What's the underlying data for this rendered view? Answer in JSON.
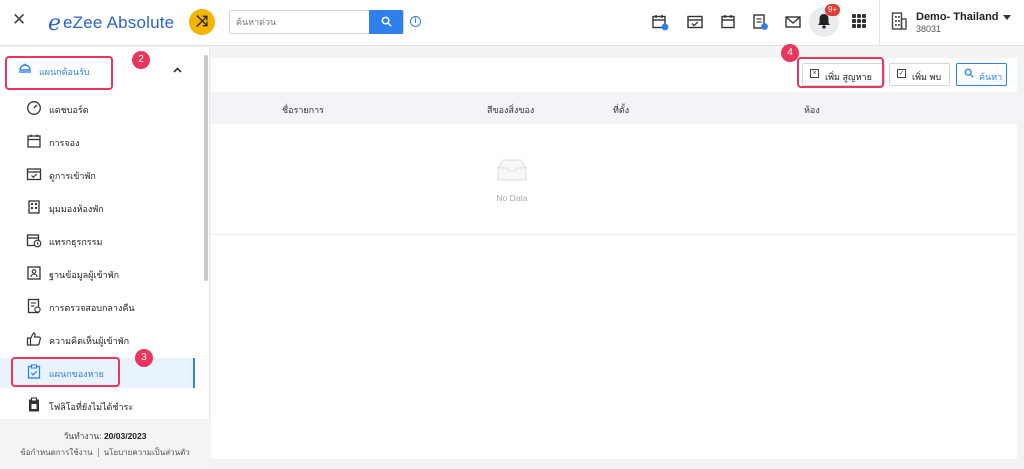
{
  "topbar": {
    "close_glyph": "✕",
    "brand_letter": "e",
    "brand_name": "eZee Absolute",
    "search_placeholder": "ค้นหาด่วน",
    "notification_badge": "9+",
    "property_name": "Demo- Thailand",
    "property_id": "38031",
    "icons": [
      "calendar-plus-icon",
      "calendar-check-icon",
      "calendar-icon",
      "report-icon",
      "mail-icon",
      "bell-icon",
      "apps-grid-icon"
    ]
  },
  "sidebar": {
    "section_label": "แผนกต้อนรับ",
    "items": [
      {
        "label": "แดชบอร์ด",
        "icon": "dashboard-gauge-icon"
      },
      {
        "label": "การจอง",
        "icon": "calendar-icon"
      },
      {
        "label": "ดูการเข้าพัก",
        "icon": "calendar-check-icon"
      },
      {
        "label": "มุมมองห้องพัก",
        "icon": "room-view-icon"
      },
      {
        "label": "แทรกธุรกรรม",
        "icon": "calendar-clock-icon"
      },
      {
        "label": "ฐานข้อมูลผู้เข้าพัก",
        "icon": "guest-database-icon"
      },
      {
        "label": "การตรวจสอบกลางคืน",
        "icon": "night-audit-icon"
      },
      {
        "label": "ความคิดเห็นผู้เข้าพัก",
        "icon": "thumbs-up-icon"
      },
      {
        "label": "แผนกของหาย",
        "icon": "lost-found-icon"
      },
      {
        "label": "โฟลิโอที่ยังไม่ได้ชำระ",
        "icon": "clipboard-icon"
      }
    ],
    "work_date_label": "วันทำงาน:",
    "work_date_value": "20/03/2023",
    "terms_link": "ข้อกำหนดการใช้งาน",
    "privacy_link": "นโยบายความเป็นส่วนตัว"
  },
  "annotations": [
    "2",
    "3",
    "4"
  ],
  "main": {
    "buttons": {
      "add_lost": "เพิ่ม สูญหาย",
      "add_found": "เพิ่ม พบ",
      "search": "ค้นหา"
    },
    "columns": [
      "ชื่อรายการ",
      "สีของสิ่งของ",
      "ที่ตั้ง",
      "ห้อง"
    ],
    "empty_text": "No Data"
  }
}
